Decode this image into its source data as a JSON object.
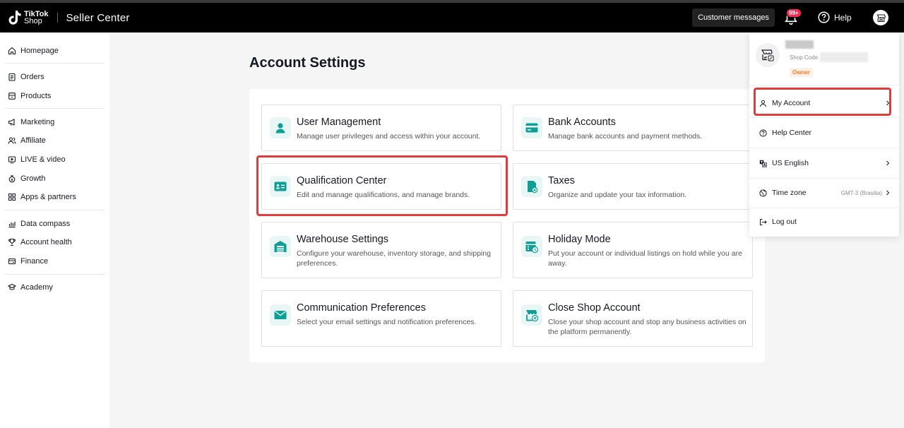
{
  "header": {
    "logo_line1": "TikTok",
    "logo_line2": "Shop",
    "app_title": "Seller Center",
    "customer_messages": "Customer messages",
    "notification_badge": "99+",
    "help": "Help"
  },
  "sidebar": {
    "items": [
      {
        "label": "Homepage",
        "icon": "home-icon"
      },
      {
        "label": "Orders",
        "icon": "clipboard-icon"
      },
      {
        "label": "Products",
        "icon": "box-icon"
      },
      {
        "label": "Marketing",
        "icon": "megaphone-icon"
      },
      {
        "label": "Affiliate",
        "icon": "users-icon"
      },
      {
        "label": "LIVE & video",
        "icon": "video-icon"
      },
      {
        "label": "Growth",
        "icon": "growth-icon"
      },
      {
        "label": "Apps & partners",
        "icon": "apps-icon"
      },
      {
        "label": "Data compass",
        "icon": "chart-icon"
      },
      {
        "label": "Account health",
        "icon": "trophy-icon"
      },
      {
        "label": "Finance",
        "icon": "wallet-icon"
      },
      {
        "label": "Academy",
        "icon": "academy-icon"
      }
    ]
  },
  "main": {
    "title": "Account Settings",
    "cards": [
      {
        "title": "User Management",
        "desc": "Manage user privileges and access within your account.",
        "icon": "user-icon"
      },
      {
        "title": "Bank Accounts",
        "desc": "Manage bank accounts and payment methods.",
        "icon": "bank-card-icon"
      },
      {
        "title": "Qualification Center",
        "desc": "Edit and manage qualifications, and manage brands.",
        "icon": "id-card-icon"
      },
      {
        "title": "Taxes",
        "desc": "Organize and update your tax information.",
        "icon": "tax-document-icon"
      },
      {
        "title": "Warehouse Settings",
        "desc": "Configure your warehouse, inventory storage, and shipping preferences.",
        "icon": "warehouse-icon"
      },
      {
        "title": "Holiday Mode",
        "desc": "Put your account or individual listings on hold while you are away.",
        "icon": "calendar-clock-icon"
      },
      {
        "title": "Communication Preferences",
        "desc": "Select your email settings and notification preferences.",
        "icon": "envelope-icon"
      },
      {
        "title": "Close Shop Account",
        "desc": "Close your shop account and stop any business activities on the platform permanently.",
        "icon": "store-close-icon"
      }
    ]
  },
  "dropdown": {
    "shop_code_label": "Shop Code",
    "role": "Owner",
    "items": [
      {
        "label": "My Account",
        "icon": "person-icon"
      },
      {
        "label": "Help Center",
        "icon": "question-icon"
      },
      {
        "label": "US English",
        "icon": "translate-icon"
      },
      {
        "label": "Time zone",
        "value": "GMT-3 (Brasilia)",
        "icon": "globe-icon"
      },
      {
        "label": "Log out",
        "icon": "logout-icon"
      }
    ]
  },
  "colors": {
    "accent_teal": "#0f9e93",
    "highlight_red": "#e03c3c",
    "badge_red": "#fe2c55",
    "owner_orange": "#ff7a2c"
  }
}
